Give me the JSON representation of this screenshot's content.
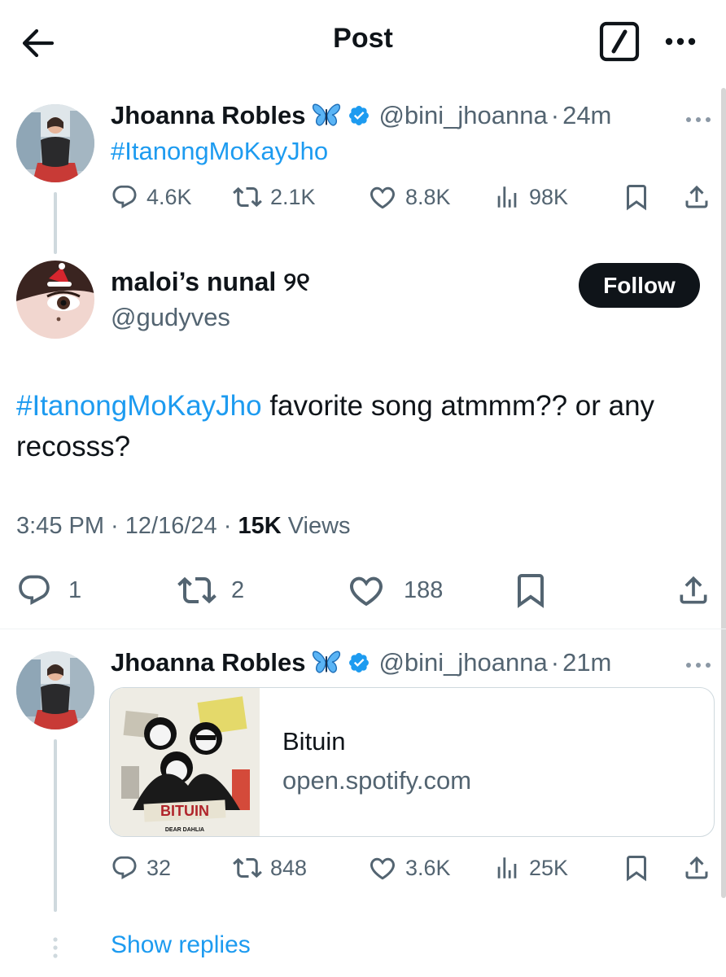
{
  "header": {
    "title": "Post"
  },
  "parent_tweet": {
    "name": "Jhoanna Robles",
    "handle": "@bini_jhoanna",
    "separator": "·",
    "time": "24m",
    "text": "#ItanongMoKayJho",
    "stats": {
      "replies": "4.6K",
      "reposts": "2.1K",
      "likes": "8.8K",
      "views": "98K"
    }
  },
  "main_tweet": {
    "name": "maloi’s nunal ୨୧",
    "handle": "@gudyves",
    "follow_label": "Follow",
    "hashtag": "#ItanongMoKayJho",
    "text": " favorite song atmmm?? or any recosss?",
    "meta": {
      "time": "3:45 PM",
      "separator": " · ",
      "date": "12/16/24",
      "views_count": "15K",
      "views_label": " Views"
    },
    "stats": {
      "replies": "1",
      "reposts": "2",
      "likes": "188"
    }
  },
  "reply_tweet": {
    "name": "Jhoanna Robles",
    "handle": "@bini_jhoanna",
    "separator": "·",
    "time": "21m",
    "card": {
      "title": "Bituin",
      "domain": "open.spotify.com",
      "album_text": "BITUIN",
      "album_subtext": "DEAR DAHLIA"
    },
    "stats": {
      "replies": "32",
      "reposts": "848",
      "likes": "3.6K",
      "views": "25K"
    },
    "show_replies_label": "Show replies"
  },
  "colors": {
    "accent": "#1d9bf0",
    "text": "#0f1419",
    "secondary": "#536471",
    "border": "#cfd9de"
  },
  "icons": [
    "back-arrow-icon",
    "compose-icon",
    "more-icon",
    "butterfly-icon",
    "verified-badge-icon",
    "reply-icon",
    "repost-icon",
    "like-icon",
    "views-icon",
    "bookmark-icon",
    "share-icon"
  ]
}
